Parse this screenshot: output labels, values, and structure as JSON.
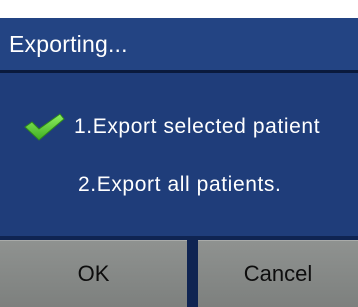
{
  "dialog": {
    "title": "Exporting...",
    "options": [
      {
        "label": "1.Export  selected patient",
        "selected": true,
        "icon": "checkmark-icon"
      },
      {
        "label": "2.Export  all patients.",
        "selected": false
      }
    ],
    "buttons": {
      "ok_label": "OK",
      "cancel_label": "Cancel"
    }
  },
  "colors": {
    "title_bar": "#234483",
    "body": "#1f3d7a",
    "bottom_bar": "#0f2452",
    "button": "#868987",
    "check": "#5fd63a",
    "text": "#ffffff"
  }
}
